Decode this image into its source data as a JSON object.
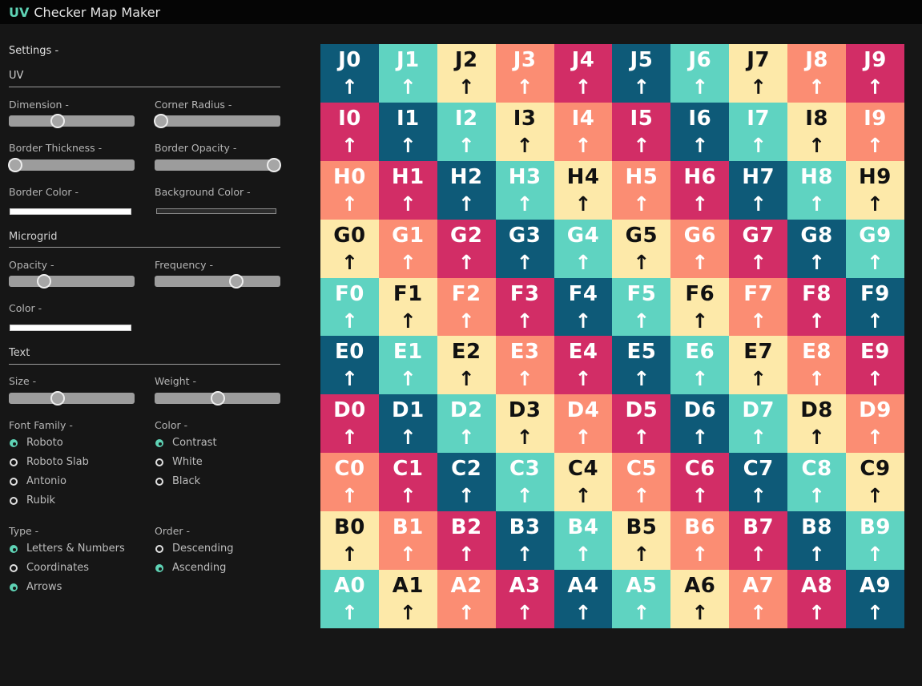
{
  "title": {
    "brand": "UV",
    "rest": "Checker Map Maker"
  },
  "panel": {
    "settings_title": "Settings -",
    "uv": {
      "title": "UV",
      "dimension": {
        "label": "Dimension -",
        "value": 0.39
      },
      "corner_radius": {
        "label": "Corner Radius -",
        "value": 0.05
      },
      "border_thickness": {
        "label": "Border Thickness -",
        "value": 0.05
      },
      "border_opacity": {
        "label": "Border Opacity -",
        "value": 0.95
      },
      "border_color": {
        "label": "Border Color -",
        "value": "#ffffff"
      },
      "background_color": {
        "label": "Background Color -",
        "value": "#2c2c2c"
      }
    },
    "microgrid": {
      "title": "Microgrid",
      "opacity": {
        "label": "Opacity -",
        "value": 0.28
      },
      "frequency": {
        "label": "Frequency -",
        "value": 0.65
      },
      "color": {
        "label": "Color -",
        "value": "#ffffff"
      }
    },
    "text": {
      "title": "Text",
      "size": {
        "label": "Size -",
        "value": 0.39
      },
      "weight": {
        "label": "Weight -",
        "value": 0.5
      },
      "font_family": {
        "label": "Font Family -",
        "options": [
          "Roboto",
          "Roboto Slab",
          "Antonio",
          "Rubik"
        ],
        "selected": "Roboto"
      },
      "color": {
        "label": "Color -",
        "options": [
          "Contrast",
          "White",
          "Black"
        ],
        "selected": "Contrast"
      },
      "type": {
        "label": "Type -",
        "options": [
          "Letters & Numbers",
          "Coordinates",
          "Arrows"
        ],
        "selected": [
          "Letters & Numbers",
          "Arrows"
        ]
      },
      "order": {
        "label": "Order -",
        "options": [
          "Descending",
          "Ascending"
        ],
        "selected": "Ascending"
      }
    }
  },
  "checker": {
    "rows": [
      "J",
      "I",
      "H",
      "G",
      "F",
      "E",
      "D",
      "C",
      "B",
      "A"
    ],
    "columns": [
      "0",
      "1",
      "2",
      "3",
      "4",
      "5",
      "6",
      "7",
      "8",
      "9"
    ],
    "arrow": "↑",
    "palette": {
      "navy": "#0e5a78",
      "teal": "#5fd3c1",
      "cream": "#fde9a9",
      "salmon": "#fb8d73",
      "magenta": "#d22d66"
    },
    "pattern": [
      "navy",
      "teal",
      "cream",
      "salmon",
      "magenta"
    ],
    "dark_text_colors": [
      "cream"
    ]
  }
}
